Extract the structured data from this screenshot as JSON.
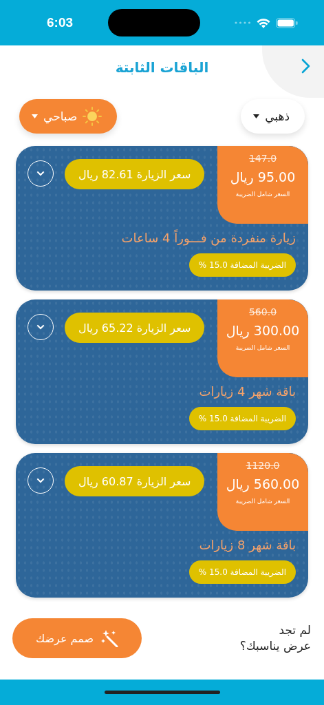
{
  "status_bar": {
    "time": "6:03"
  },
  "header": {
    "title": "الباقات الثابتة"
  },
  "filters": [
    {
      "kind": "plan",
      "label": "ذهبي"
    },
    {
      "kind": "period",
      "label": "صباحي"
    }
  ],
  "packages": [
    {
      "old_price": "147.0",
      "price": "95.00 ريال",
      "price_note": "السعر شامل الضريبة",
      "visit_price": "سعر الزيارة 82.61 ريال",
      "title": "زيارة منفردة من فـــوراً 4 ساعات",
      "tax": "الضريبة المضافة 15.0 %"
    },
    {
      "old_price": "560.0",
      "price": "300.00 ريال",
      "price_note": "السعر شامل الضريبة",
      "visit_price": "سعر الزيارة 65.22 ريال",
      "title": "باقة شهر 4 زيارات",
      "tax": "الضريبة المضافة 15.0 %"
    },
    {
      "old_price": "1120.0",
      "price": "560.00 ريال",
      "price_note": "السعر شامل الضريبة",
      "visit_price": "سعر الزيارة 60.87 ريال",
      "title": "باقة شهر 8 زيارات",
      "tax": "الضريبة المضافة 15.0 %"
    }
  ],
  "footer": {
    "prompt": "لم تجد\nعرض يناسبك؟",
    "button": "صمم عرضك"
  }
}
